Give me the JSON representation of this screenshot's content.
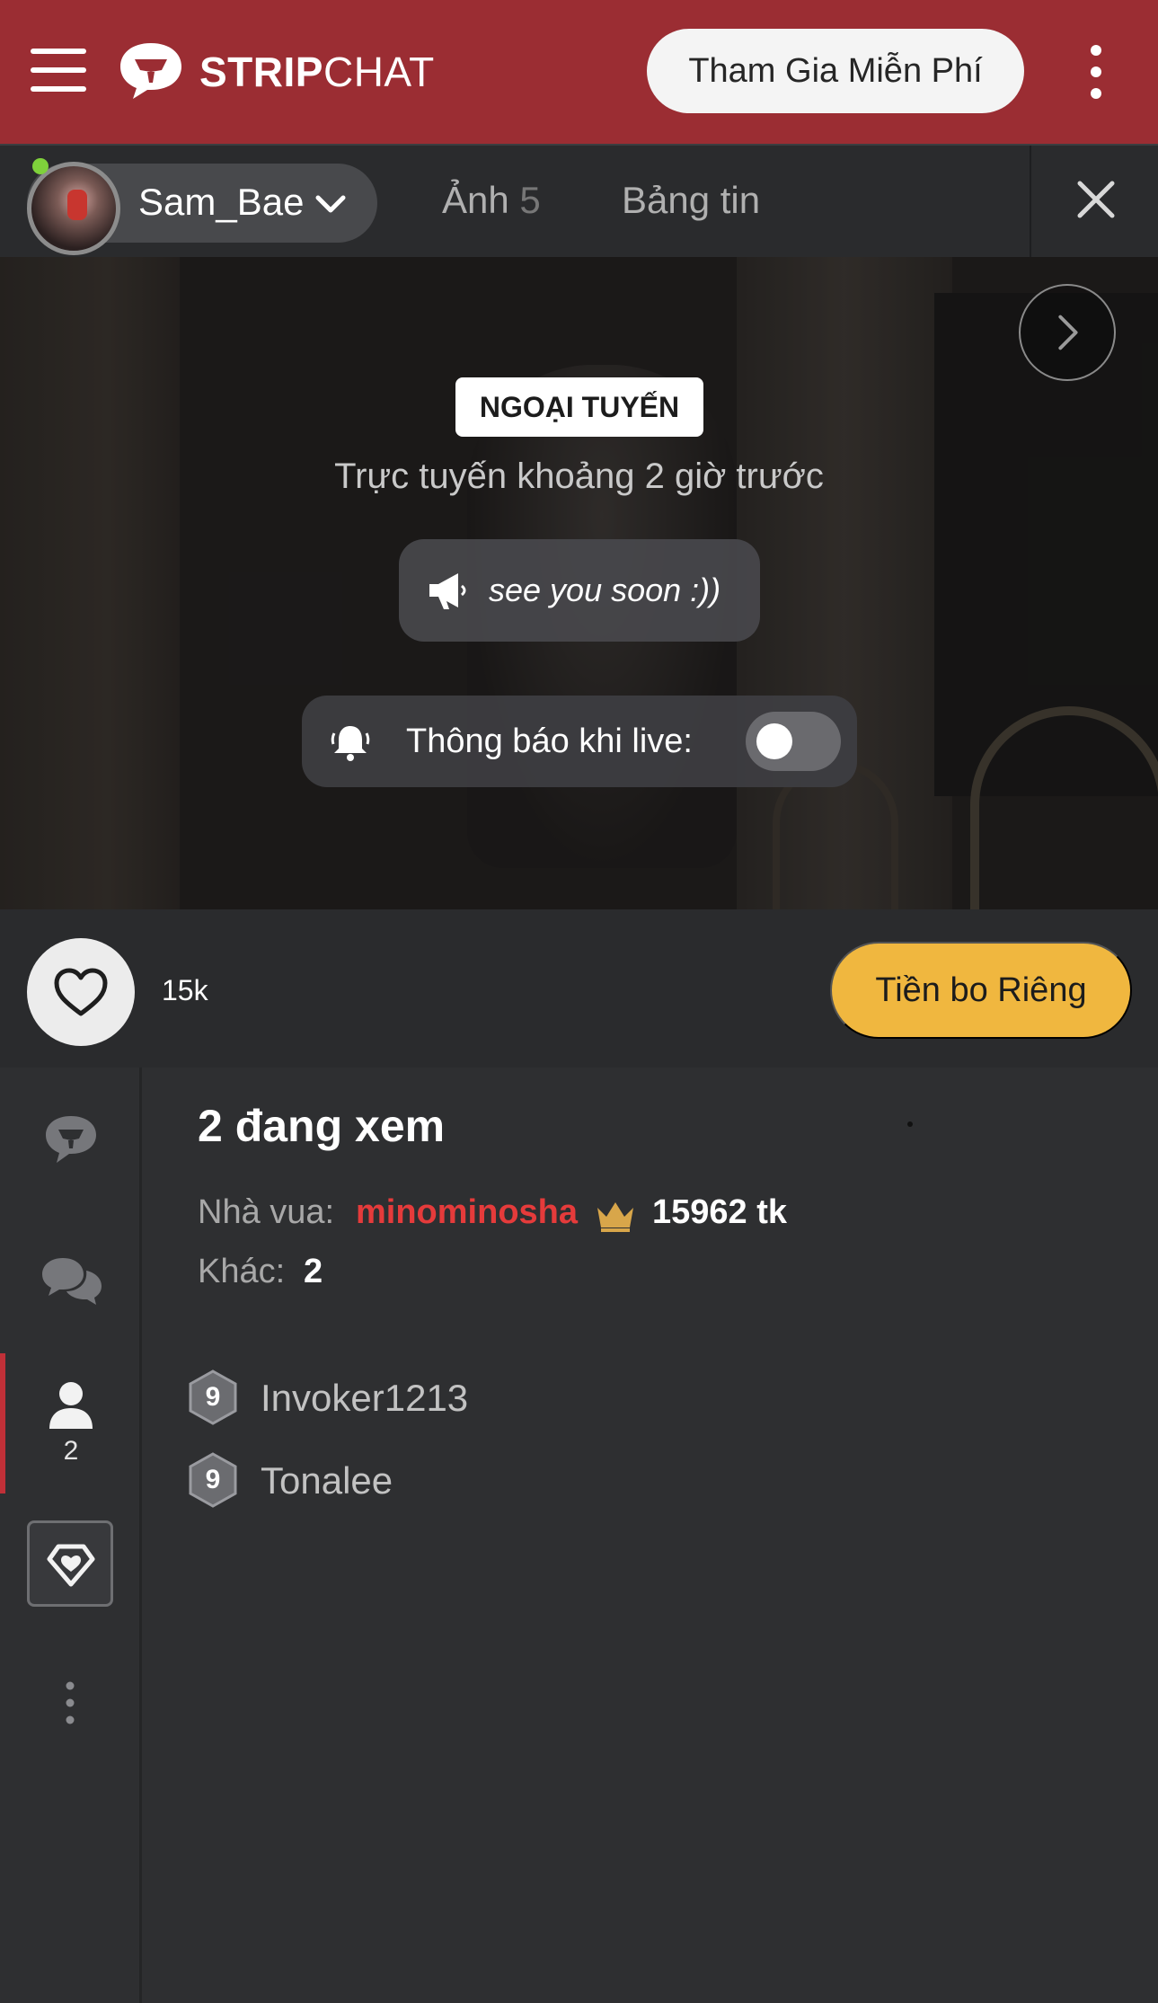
{
  "header": {
    "logo_bold": "STRIP",
    "logo_thin": "CHAT",
    "join_label": "Tham Gia Miễn Phí"
  },
  "model_bar": {
    "model_name": "Sam_Bae",
    "tabs": [
      {
        "label": "Ảnh",
        "count": "5"
      },
      {
        "label": "Bảng tin"
      }
    ]
  },
  "player": {
    "status_badge": "NGOẠI TUYẾN",
    "last_seen": "Trực tuyến khoảng 2 giờ trước",
    "message": "see you soon :))",
    "notify_label": "Thông báo khi live:",
    "notify_enabled": false
  },
  "actions": {
    "likes_count": "15k",
    "tip_label": "Tiền bo Riêng"
  },
  "sidebar": {
    "users_count": "2"
  },
  "viewers": {
    "title": "2 đang xem",
    "king_label": "Nhà vua:",
    "king_name": "minominosha",
    "king_tokens": "15962 tk",
    "other_label": "Khác:",
    "other_count": "2",
    "users": [
      {
        "level": "9",
        "name": "Invoker1213"
      },
      {
        "level": "9",
        "name": "Tonalee"
      }
    ]
  },
  "colors": {
    "header_bg": "#9b2d33",
    "tip_button": "#f0b73f",
    "king_name": "#e53b3b",
    "active_indicator": "#c03038",
    "online_dot": "#7fd13b"
  }
}
